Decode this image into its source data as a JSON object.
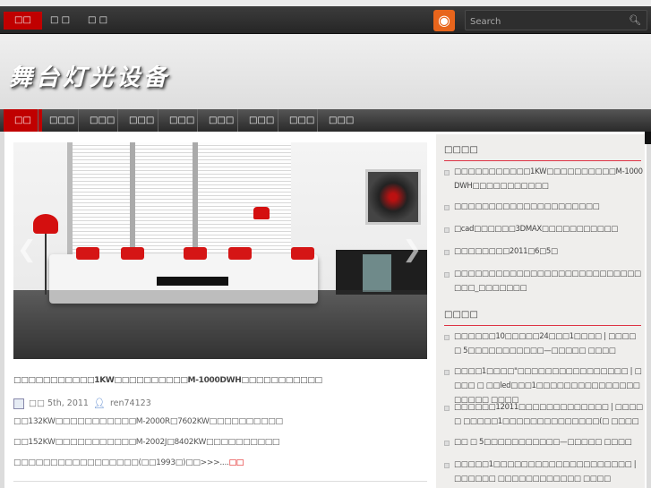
{
  "top_nav": [
    "□□",
    "□ □",
    "□ □"
  ],
  "search": {
    "placeholder": "Search"
  },
  "site_title": "舞台灯光设备",
  "main_nav": [
    "□□",
    "□□□",
    "□□□",
    "□□□",
    "□□□",
    "□□□",
    "□□□",
    "□□□",
    "□□□"
  ],
  "post": {
    "title": "□□□□□□□□□□□1KW□□□□□□□□□□M-1000DWH□□□□□□□□□□□",
    "date": "□□ 5th, 2011",
    "author": "ren74123",
    "lines": [
      "□□132KW□□□□□□□□□□□M-2000R□7602KW□□□□□□□□□□",
      "□□152KW□□□□□□□□□□□M-2002J□8402KW□□□□□□□□□□",
      "□□□□□□□□□□□□□□□□□(□□1993□)□□>>>...."
    ],
    "more": "□□"
  },
  "sidebar": {
    "recent_title": "□□□□",
    "recent": [
      "□□□□□□□□□□□1KW□□□□□□□□□□M-1000DWH□□□□□□□□□□□",
      "□□□□□□□□□□□□□□□□□□□□□",
      "□cad□□□□□□3DMAX□□□□□□□□□□□",
      "□□□□□□□□2011□6□5□",
      "□□□□□□□□□□□□□□□□□□□□□□□□□□□□□□_□□□□□□□"
    ],
    "other_title": "□□□□",
    "other": [
      "□□□□□□10□□□□□24□□□1□□□□ | □□□□ □ 5□□□□□□□□□□□—□□□□□ □□□□",
      "□□□□1□□□□\"□□□□□□□□□□□□□□□□ | □□□□ □ □□led□□□1□□□□□□□□□□□□□□□□□□□□ □□□□",
      "□□□□□□12011□□□□□□□□□□□□□ | □□□□ □ □□□□□1□□□□□□□□□□□□□□(□ □□□□",
      "□□ □ 5□□□□□□□□□□□—□□□□□ □□□□",
      "□□□□□1□□□□□□□□□□□□□□□□□□□□ | □□□□□□ □□□□□□□□□□□□ □□□□"
    ]
  },
  "colors": {
    "accent": "#c00000",
    "rss": "#e8651c"
  }
}
